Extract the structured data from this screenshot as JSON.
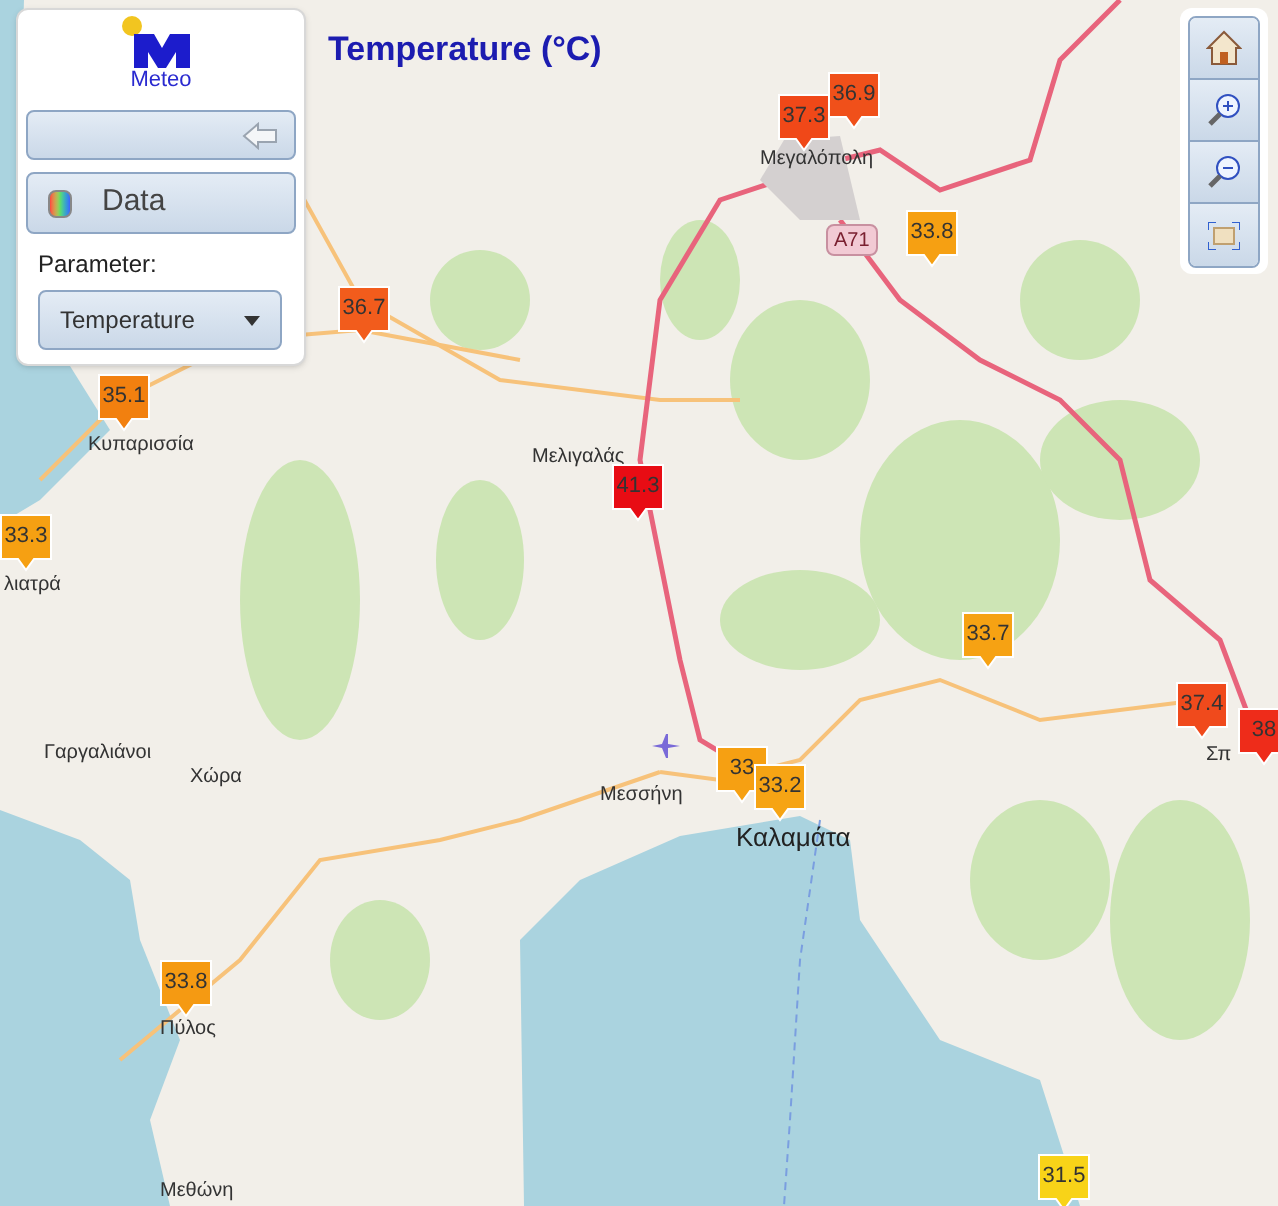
{
  "title": "Temperature (°C)",
  "panel": {
    "logo_text": "Meteo",
    "data_button": "Data",
    "parameter_label": "Parameter:",
    "parameter_select": "Temperature"
  },
  "road_shield": "A71",
  "place_labels": [
    "Μεγαλόπολη",
    "Κυπαρισσία",
    "Μελιγαλάς",
    "λιατρά",
    "Γαργαλιάνοι",
    "Χώρα",
    "Μεσσήνη",
    "Καλαμάτα",
    "Σπ",
    "Πύλος",
    "Μεθώνη"
  ],
  "markers": [
    {
      "value": "36.9",
      "color": "#f0501a"
    },
    {
      "value": "37.3",
      "color": "#f04818"
    },
    {
      "value": "33.8",
      "color": "#f6a012"
    },
    {
      "value": "36.7",
      "color": "#f25c1c"
    },
    {
      "value": "35.1",
      "color": "#f2800f"
    },
    {
      "value": "33.3",
      "color": "#f6a012"
    },
    {
      "value": "41.3",
      "color": "#e80c14"
    },
    {
      "value": "33.7",
      "color": "#f6a213"
    },
    {
      "value": "33",
      "color": "#f6a012"
    },
    {
      "value": "33.2",
      "color": "#f6a414"
    },
    {
      "value": "37.4",
      "color": "#f04a1c"
    },
    {
      "value": "38",
      "color": "#ee2c1a"
    },
    {
      "value": "33.8",
      "color": "#f59a12"
    },
    {
      "value": "31.5",
      "color": "#f8d318"
    }
  ]
}
